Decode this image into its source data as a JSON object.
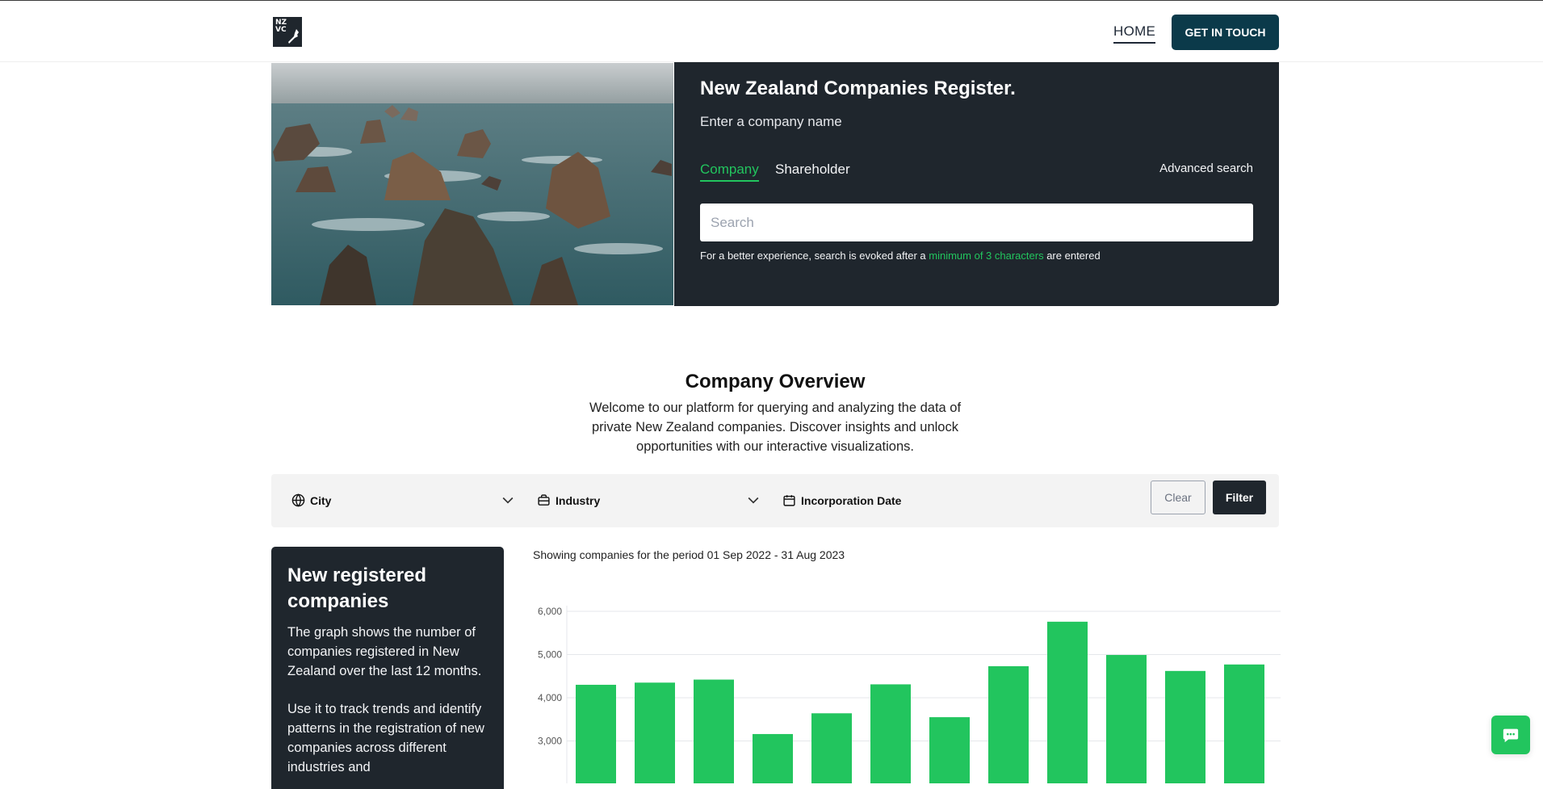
{
  "header": {
    "logo_line1": "NZ",
    "logo_line2": "VC",
    "nav_home": "HOME",
    "cta": "GET IN TOUCH"
  },
  "hero": {
    "title": "New Zealand Companies Register.",
    "subtitle": "Enter a company name",
    "tabs": [
      {
        "label": "Company",
        "active": true
      },
      {
        "label": "Shareholder",
        "active": false
      }
    ],
    "advanced_search": "Advanced search",
    "search_placeholder": "Search",
    "hint_prefix": "For a better experience, search is evoked after a ",
    "hint_highlight": "minimum of 3 characters",
    "hint_suffix": " are entered"
  },
  "overview": {
    "title": "Company Overview",
    "text": "Welcome to our platform for querying and analyzing the data of private New Zealand companies. Discover insights and unlock opportunities with our interactive visualizations."
  },
  "filters": {
    "city": "City",
    "industry": "Industry",
    "incorporation_date": "Incorporation Date",
    "clear": "Clear",
    "filter": "Filter"
  },
  "sidebar": {
    "title": "New registered companies",
    "para1": "The graph shows the number of companies registered in New Zealand over the last 12 months.",
    "para2": "Use it to track trends and identify patterns in the registration of new companies across different industries and"
  },
  "period_text": "Showing companies for the period 01 Sep 2022 - 31 Aug 2023",
  "colors": {
    "accent": "#22c55e",
    "dark": "#1f262d",
    "cta": "#0b3a4a"
  },
  "chart_data": {
    "type": "bar",
    "values": [
      4300,
      4350,
      4420,
      3160,
      3640,
      4310,
      3550,
      4730,
      5760,
      4990,
      4620,
      4770
    ],
    "yticks": [
      "6,000",
      "5,000",
      "4,000",
      "3,000"
    ],
    "ylim": [
      2000,
      6000
    ],
    "grid": true
  }
}
